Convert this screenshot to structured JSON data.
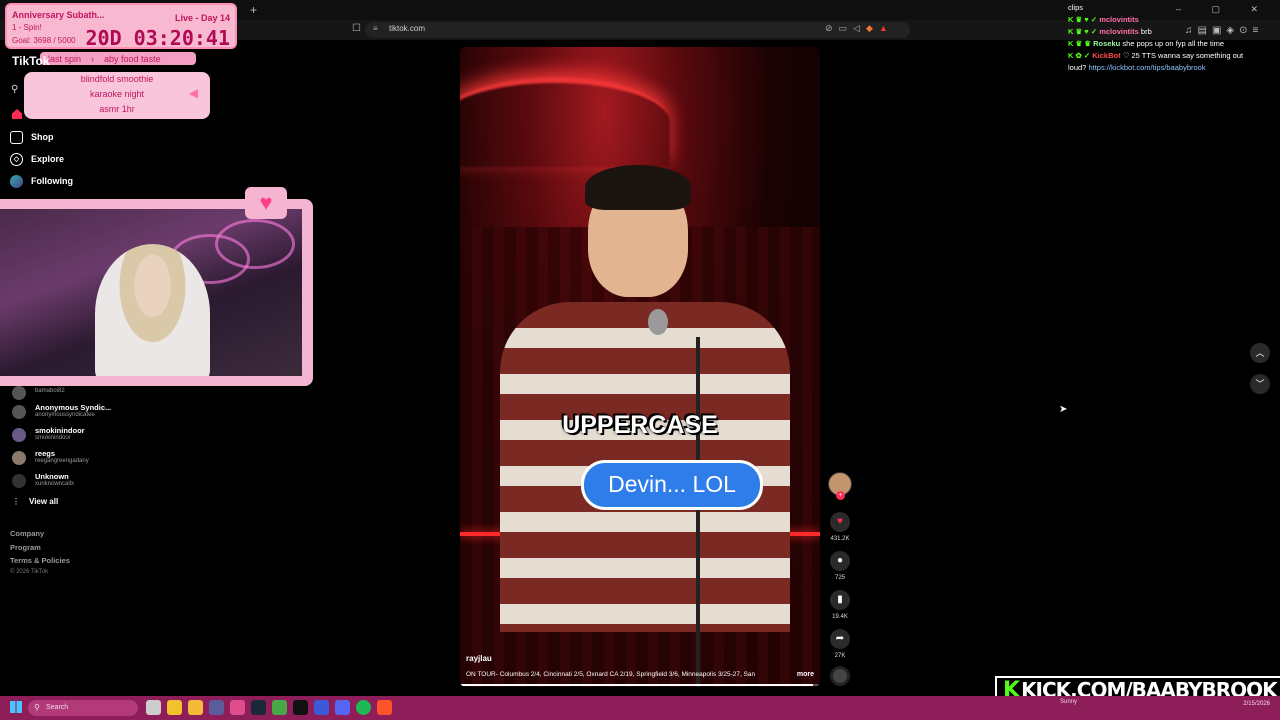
{
  "browser": {
    "url": "tiktok.com",
    "new_tab": "+",
    "window_controls": "– ▢ ✕"
  },
  "subathon": {
    "title": "Anniversary Subath...",
    "live": "Live - Day 14",
    "spin": "1 - Spin!",
    "goal": "Goal: 3698 / 5000",
    "timer": "20D 03:20:41"
  },
  "wheel": {
    "last_spin_label": "last spin",
    "last_spin_value": "aby food taste",
    "options": [
      "blindfold smoothie",
      "karaoke night",
      "asmr 1hr"
    ]
  },
  "sidebar": {
    "logo": "TikTok",
    "nav": [
      {
        "label": "Shop",
        "icon": "shop-icon"
      },
      {
        "label": "Explore",
        "icon": "compass-icon"
      },
      {
        "label": "Following",
        "icon": "following-icon"
      }
    ],
    "following": [
      {
        "name": "",
        "handle": "bamaboi82"
      },
      {
        "name": "Anonymous Syndic...",
        "handle": "anonymoussyndicatee"
      },
      {
        "name": "smokinindoor",
        "handle": "smokinindoor"
      },
      {
        "name": "reegs",
        "handle": "reegangreengadany"
      },
      {
        "name": "Unknown",
        "handle": "xunknowncallx"
      }
    ],
    "view_all": "View all",
    "footer": [
      "Company",
      "Program",
      "Terms & Policies"
    ],
    "copyright": "© 2026 TikTok"
  },
  "video": {
    "caption_main": "UPPERCASE",
    "caption_bubble": "Devin... LOL",
    "username": "rayjlau",
    "description": "ON TOUR- Columbus 2/4, Cincinnati 2/5, Oxnard CA 2/19, Springfield 3/6, Minneapolis 3/25-27, San",
    "more": "more",
    "progress_fraction": 0.98
  },
  "actions": {
    "likes": "431.2K",
    "comments": "725",
    "saves": "19.4K",
    "shares": "27K"
  },
  "chat": {
    "header": "clips",
    "messages": [
      {
        "user": "mclovintits",
        "text": "",
        "color": "pink"
      },
      {
        "user": "mclovintits",
        "text": "brb",
        "color": "pink"
      },
      {
        "user": "Roseku",
        "text": "she pops up on fyp all the time",
        "color": "teal"
      },
      {
        "user": "KickBot",
        "text": "♡ 25 TTS wanna say something out",
        "color": "red"
      }
    ],
    "continuation": "loud?",
    "link": "https://kickbot.com/tips/baabybrook"
  },
  "banner": {
    "text": "KICK.COM/BAABYBROOK"
  },
  "taskbar": {
    "search_placeholder": "Search",
    "weather": "Sunny",
    "date": "2/15/2026"
  },
  "colors": {
    "overlay_pink": "#f8b8cf",
    "tiktok_red": "#fe2c55",
    "kick_green": "#53fc18",
    "taskbar": "#8e1e5a",
    "bubble_blue": "#2f7de8"
  }
}
